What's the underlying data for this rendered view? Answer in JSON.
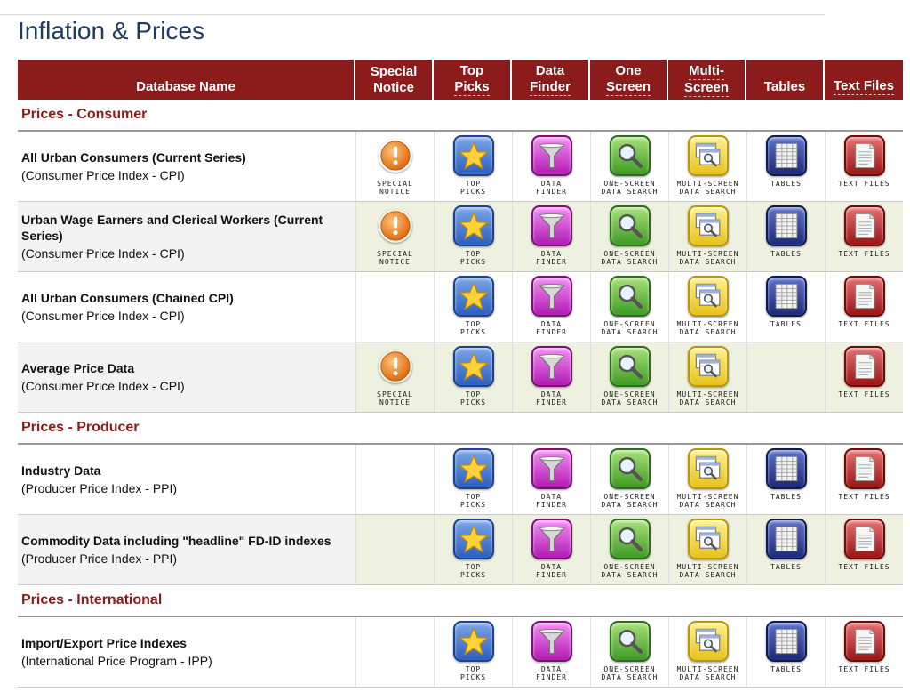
{
  "page": {
    "title": "Inflation & Prices"
  },
  "header": {
    "database_name": "Database Name",
    "special_notice": [
      "Special",
      "Notice"
    ],
    "top_picks": [
      "Top",
      "Picks"
    ],
    "data_finder": [
      "Data",
      "Finder"
    ],
    "one_screen": [
      "One",
      "Screen"
    ],
    "multi_screen": [
      "Multi-",
      "Screen"
    ],
    "tables": "Tables",
    "text_files": "Text Files"
  },
  "icon_labels": {
    "special_notice": [
      "SPECIAL",
      "NOTICE"
    ],
    "top_picks": [
      "TOP",
      "PICKS"
    ],
    "data_finder": [
      "DATA",
      "FINDER"
    ],
    "one_screen": [
      "ONE-SCREEN",
      "DATA SEARCH"
    ],
    "multi_screen": [
      "MULTI-SCREEN",
      "DATA SEARCH"
    ],
    "tables": [
      "TABLES",
      ""
    ],
    "text_files": [
      "TEXT FILES",
      ""
    ]
  },
  "icons": {
    "special_notice": "exclamation-circle-icon",
    "top_picks": "star-icon",
    "data_finder": "funnel-icon",
    "one_screen": "magnifier-icon",
    "multi_screen": "multi-window-magnifier-icon",
    "tables": "table-icon",
    "text_files": "document-icon"
  },
  "colors": {
    "header_bg": "#8c1c1c",
    "section_text": "#8c1c1c",
    "title": "#1f3a63"
  },
  "sections": [
    {
      "title": "Prices - Consumer",
      "rows": [
        {
          "name": "All Urban Consumers (Current Series)",
          "sub": "(Consumer Price Index - CPI)",
          "special_notice": true,
          "tables": true
        },
        {
          "name": "Urban Wage Earners and Clerical Workers (Current Series)",
          "sub": "(Consumer Price Index - CPI)",
          "special_notice": true,
          "tables": true
        },
        {
          "name": "All Urban Consumers (Chained CPI)",
          "sub": "(Consumer Price Index - CPI)",
          "special_notice": false,
          "tables": true
        },
        {
          "name": "Average Price Data",
          "sub": "(Consumer Price Index - CPI)",
          "special_notice": true,
          "tables": false
        }
      ]
    },
    {
      "title": "Prices - Producer",
      "rows": [
        {
          "name": "Industry Data",
          "sub": "(Producer Price Index - PPI)",
          "special_notice": false,
          "tables": true
        },
        {
          "name": "Commodity Data including \"headline\" FD-ID indexes",
          "sub": "(Producer Price Index - PPI)",
          "special_notice": false,
          "tables": true
        }
      ]
    },
    {
      "title": "Prices - International",
      "rows": [
        {
          "name": "Import/Export Price Indexes",
          "sub": "(International Price Program - IPP)",
          "special_notice": false,
          "tables": true
        }
      ]
    }
  ]
}
